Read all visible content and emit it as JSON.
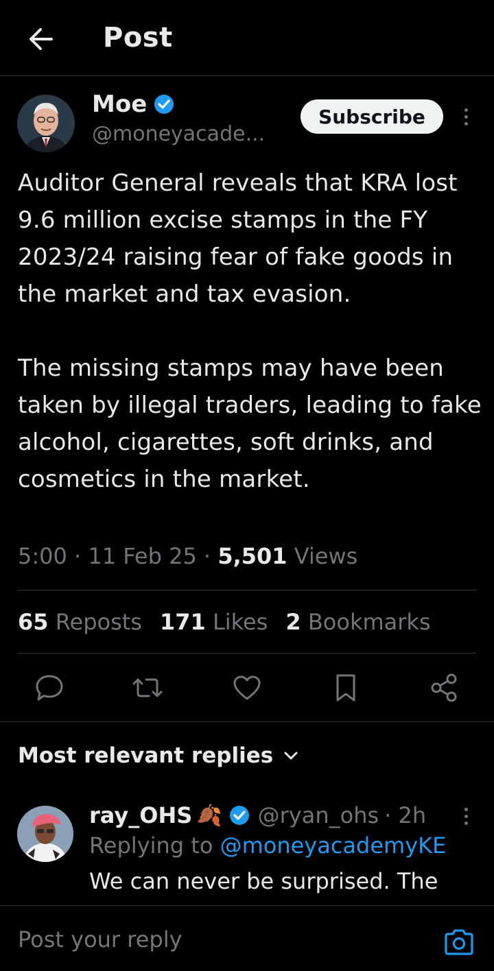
{
  "header": {
    "title": "Post",
    "back_icon": "arrow-left-icon"
  },
  "author": {
    "name": "Moe",
    "handle": "@moneyacade...",
    "verified": true,
    "subscribe_label": "Subscribe"
  },
  "post": {
    "text": "Auditor General reveals that KRA lost 9.6 million excise stamps in the FY 2023/24 raising fear of fake goods in the market and tax evasion.\n\nThe missing stamps may have been taken by illegal traders, leading to fake alcohol, cigarettes, soft drinks, and cosmetics in the market.",
    "time": "5:00",
    "date": "11 Feb 25",
    "views_count": "5,501",
    "views_label": "Views",
    "separator": " · "
  },
  "stats": {
    "reposts_count": "65",
    "reposts_label": "Reposts",
    "likes_count": "171",
    "likes_label": "Likes",
    "bookmarks_count": "2",
    "bookmarks_label": "Bookmarks"
  },
  "actions": [
    "reply-icon",
    "repost-icon",
    "like-icon",
    "bookmark-icon",
    "share-icon"
  ],
  "replies_section": {
    "title": "Most relevant replies"
  },
  "reply": {
    "name": "ray_OHS",
    "emoji": "🍂",
    "handle": "@ryan_ohs",
    "time": "· 2h",
    "replying_prefix": "Replying to",
    "replying_to": "@moneyacademyKE",
    "text": "We can never be surprised. The"
  },
  "composer": {
    "placeholder": "Post your reply"
  },
  "colors": {
    "accent": "#1d9bf0",
    "muted": "#71767b",
    "text": "#e7e9ea",
    "divider": "#2f3336"
  }
}
